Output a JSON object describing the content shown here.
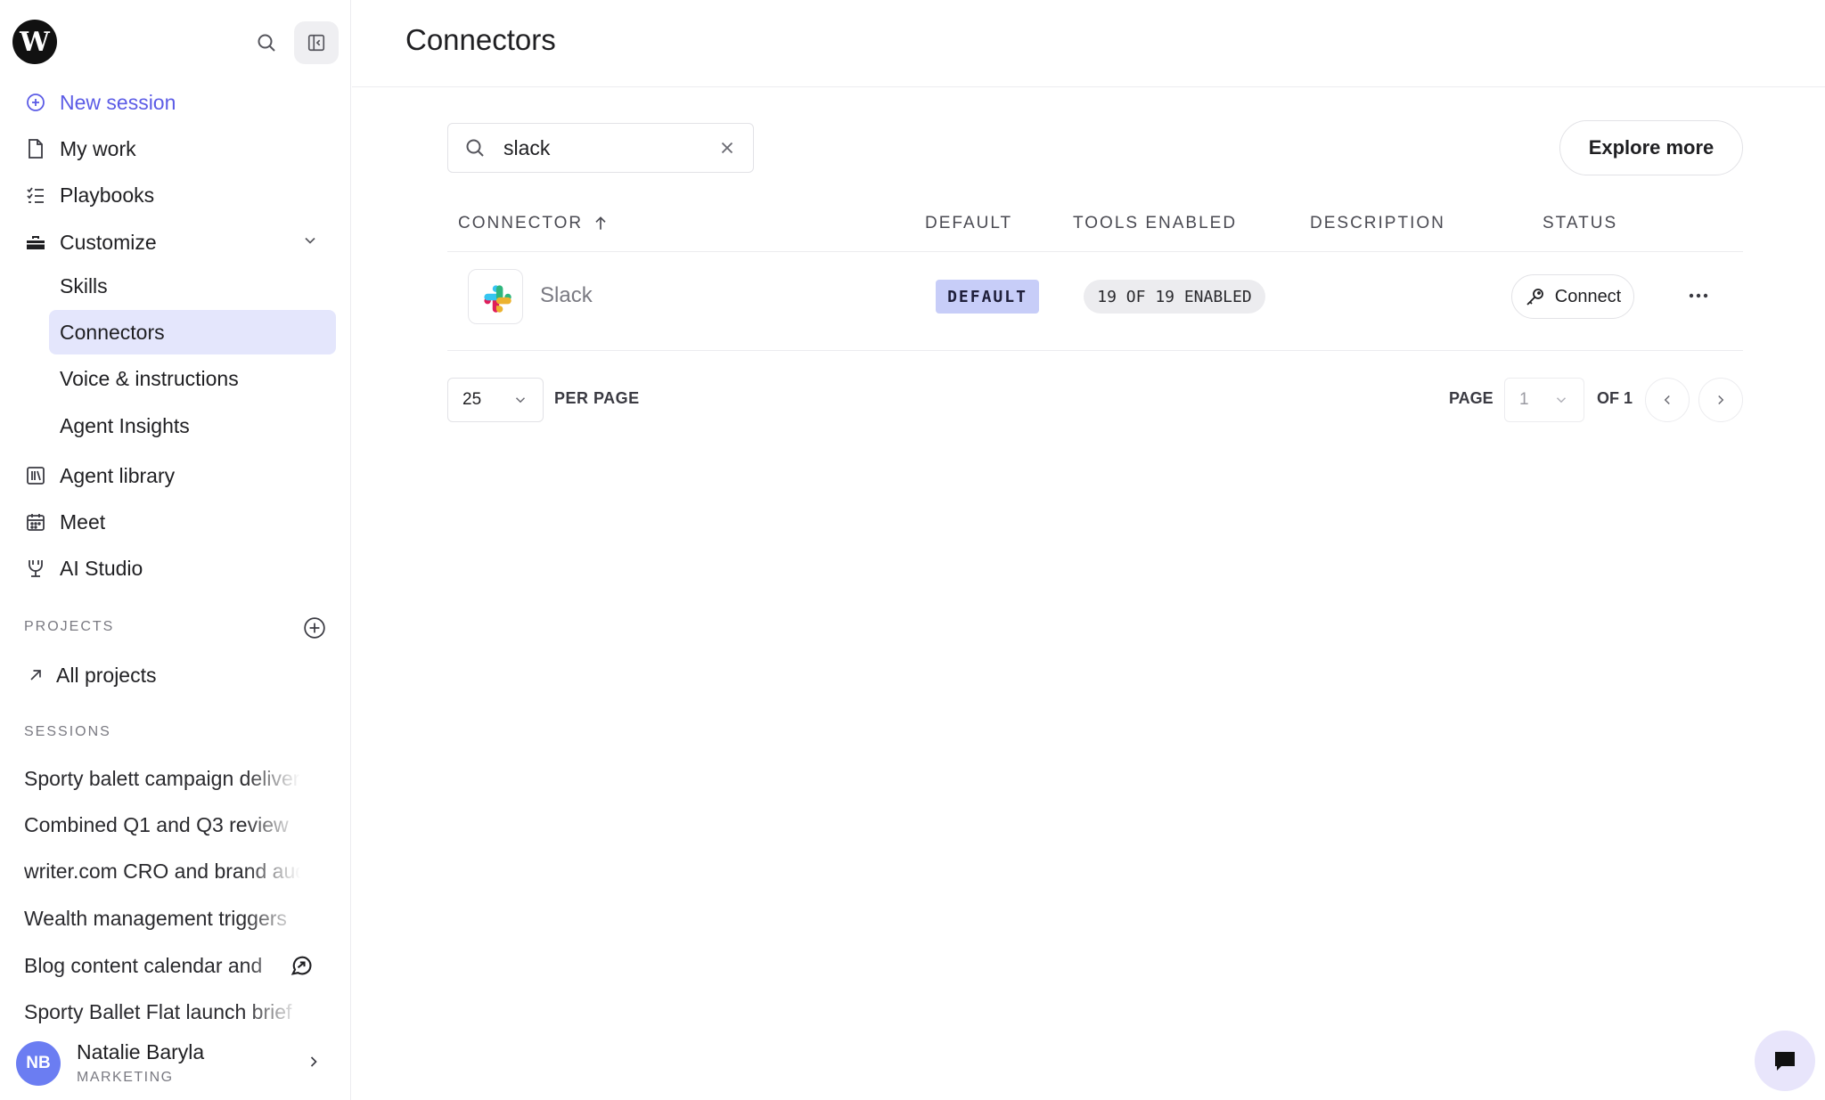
{
  "brand": {
    "logo_letter": "W",
    "accent": "#5c5ce6"
  },
  "sidebar": {
    "new_session": "New session",
    "my_work": "My work",
    "playbooks": "Playbooks",
    "customize": "Customize",
    "customize_items": [
      "Skills",
      "Connectors",
      "Voice & instructions",
      "Agent Insights"
    ],
    "agent_library": "Agent library",
    "meet": "Meet",
    "ai_studio": "AI Studio",
    "projects_label": "PROJECTS",
    "all_projects": "All projects",
    "sessions_label": "SESSIONS",
    "sessions": [
      "Sporty balett campaign delivery",
      "Combined Q1 and Q3 review",
      "writer.com CRO and brand audit",
      "Wealth management triggers",
      "Blog content calendar and",
      "Sporty Ballet Flat launch brief"
    ],
    "user": {
      "initials": "NB",
      "name": "Natalie Baryla",
      "role": "MARKETING"
    }
  },
  "main": {
    "title": "Connectors",
    "search": {
      "value": "slack",
      "placeholder": ""
    },
    "explore_more": "Explore more",
    "columns": {
      "connector": "CONNECTOR",
      "default": "DEFAULT",
      "tools_enabled": "TOOLS ENABLED",
      "description": "DESCRIPTION",
      "status": "STATUS"
    },
    "rows": [
      {
        "name": "Slack",
        "default_badge": "DEFAULT",
        "tools": "19 OF 19 ENABLED",
        "description": "",
        "action": "Connect"
      }
    ],
    "pagination": {
      "per_page_value": "25",
      "per_page_label": "PER PAGE",
      "page_label": "PAGE",
      "page_value": "1",
      "of_label": "OF 1"
    }
  }
}
